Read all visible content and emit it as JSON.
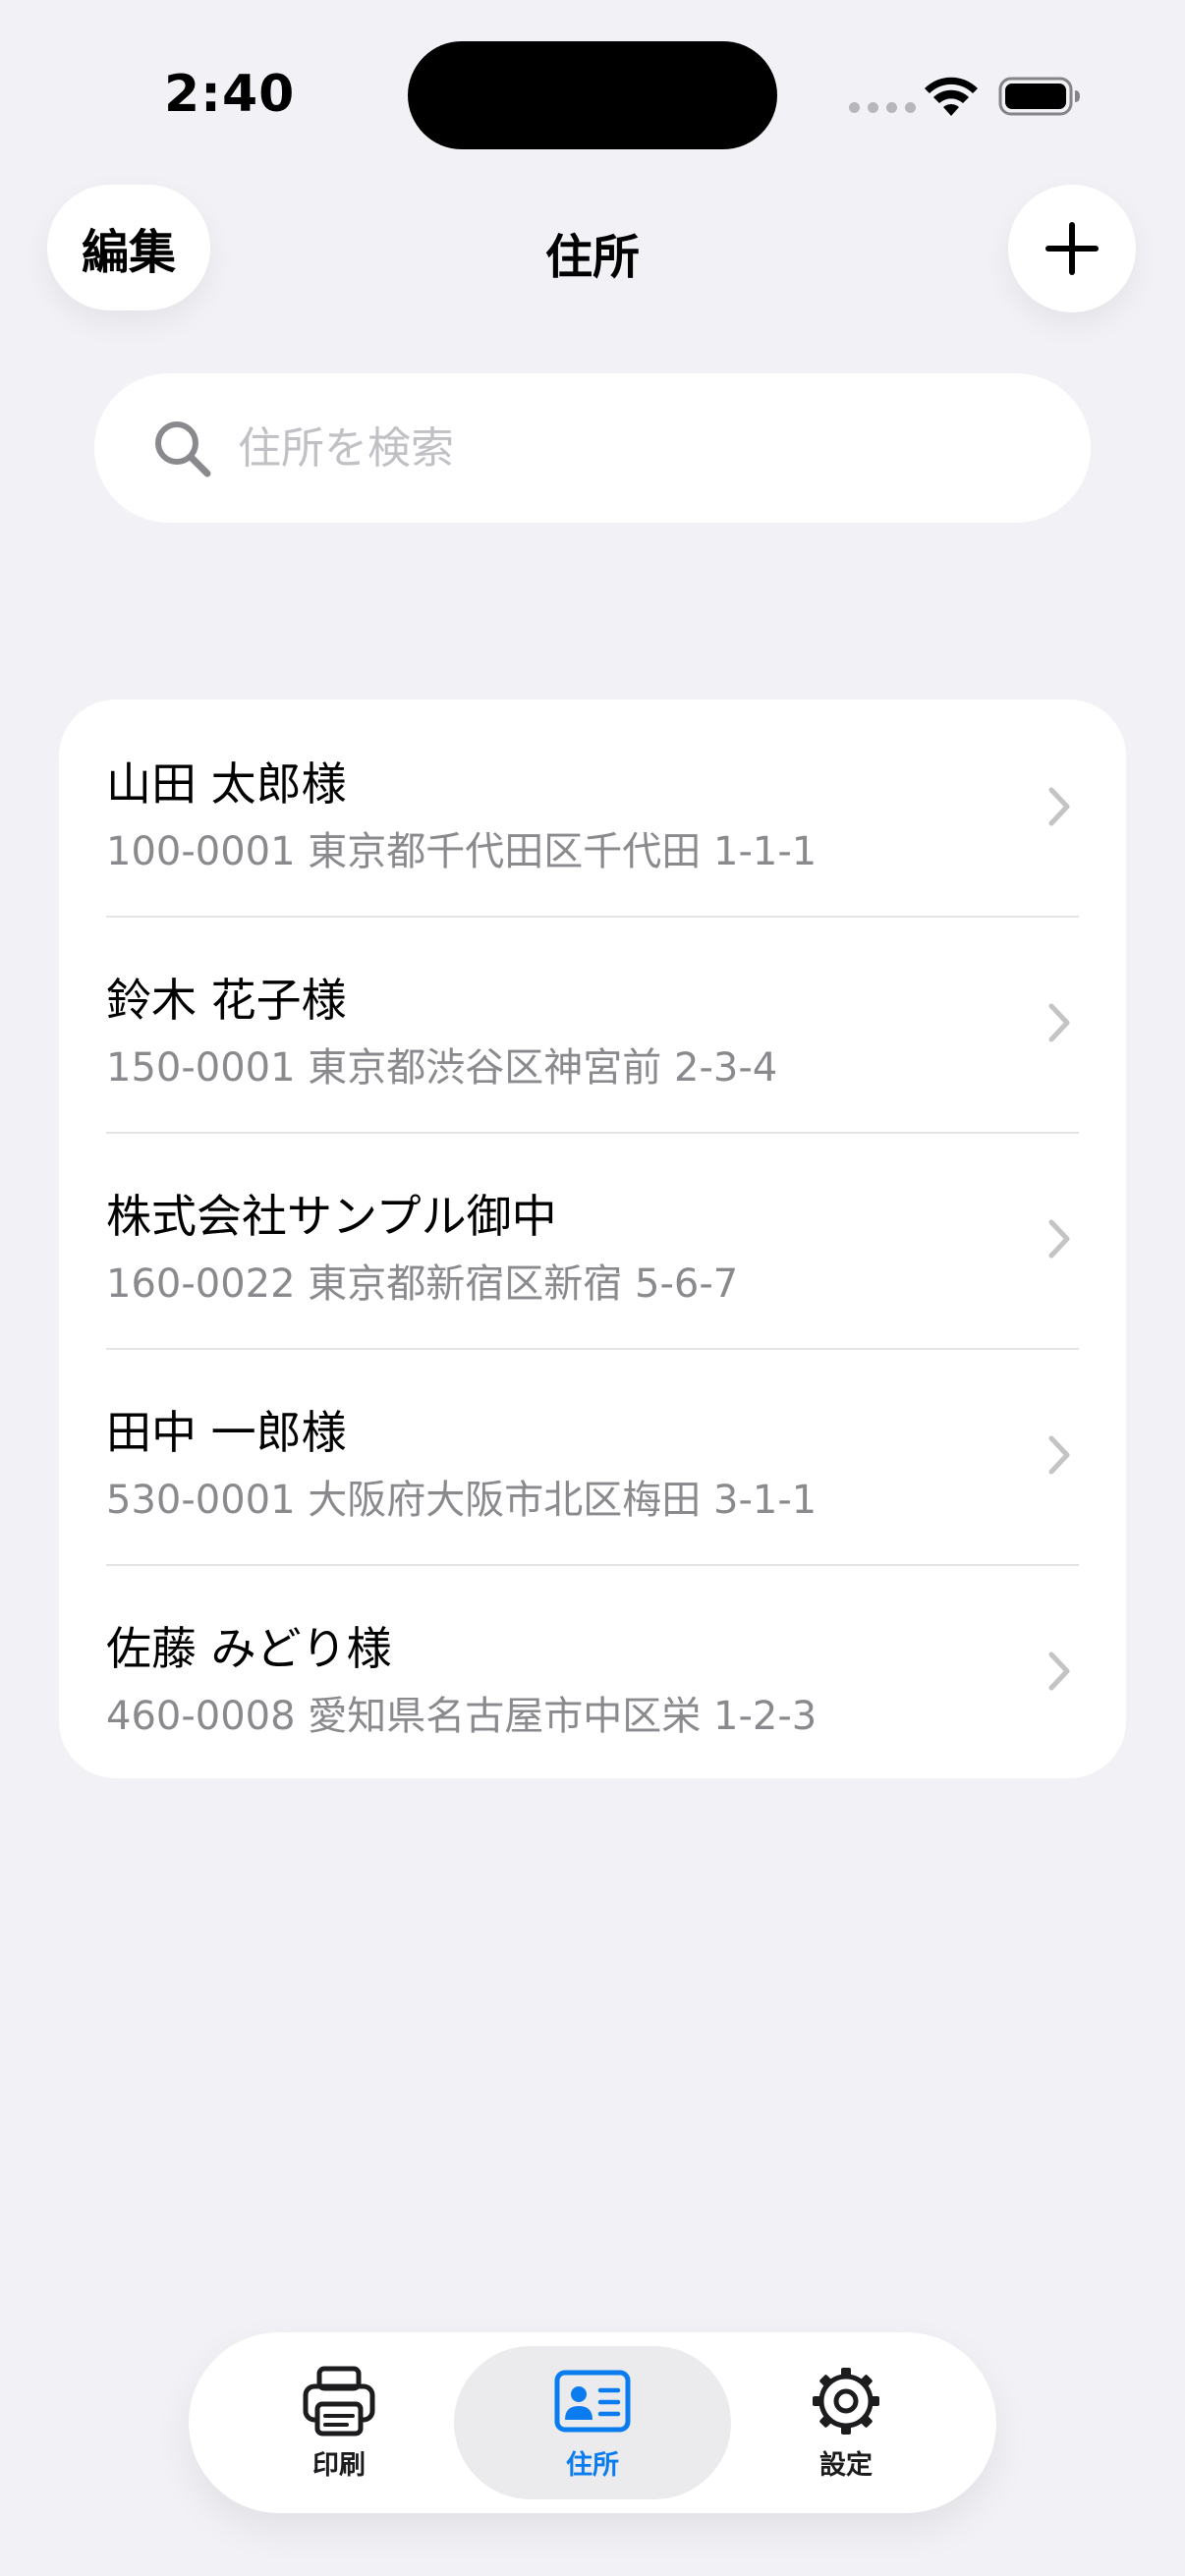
{
  "status_bar": {
    "time": "2:40"
  },
  "nav": {
    "edit_label": "編集",
    "title": "住所",
    "add_icon": "plus-icon"
  },
  "search": {
    "placeholder": "住所を検索",
    "value": ""
  },
  "addresses": [
    {
      "name": "山田 太郎様",
      "address": "100-0001 東京都千代田区千代田 1-1-1"
    },
    {
      "name": "鈴木 花子様",
      "address": "150-0001 東京都渋谷区神宮前 2-3-4"
    },
    {
      "name": "株式会社サンプル御中",
      "address": "160-0022 東京都新宿区新宿 5-6-7"
    },
    {
      "name": "田中 一郎様",
      "address": "530-0001 大阪府大阪市北区梅田 3-1-1"
    },
    {
      "name": "佐藤 みどり様",
      "address": "460-0008 愛知県名古屋市中区栄 1-2-3"
    }
  ],
  "tabs": [
    {
      "label": "印刷",
      "icon": "printer-icon",
      "active": false
    },
    {
      "label": "住所",
      "icon": "contact-card-icon",
      "active": true
    },
    {
      "label": "設定",
      "icon": "gear-icon",
      "active": false
    }
  ],
  "colors": {
    "background": "#f2f2f6",
    "accent": "#0a7cf0",
    "secondary_text": "#8a8a8e"
  }
}
